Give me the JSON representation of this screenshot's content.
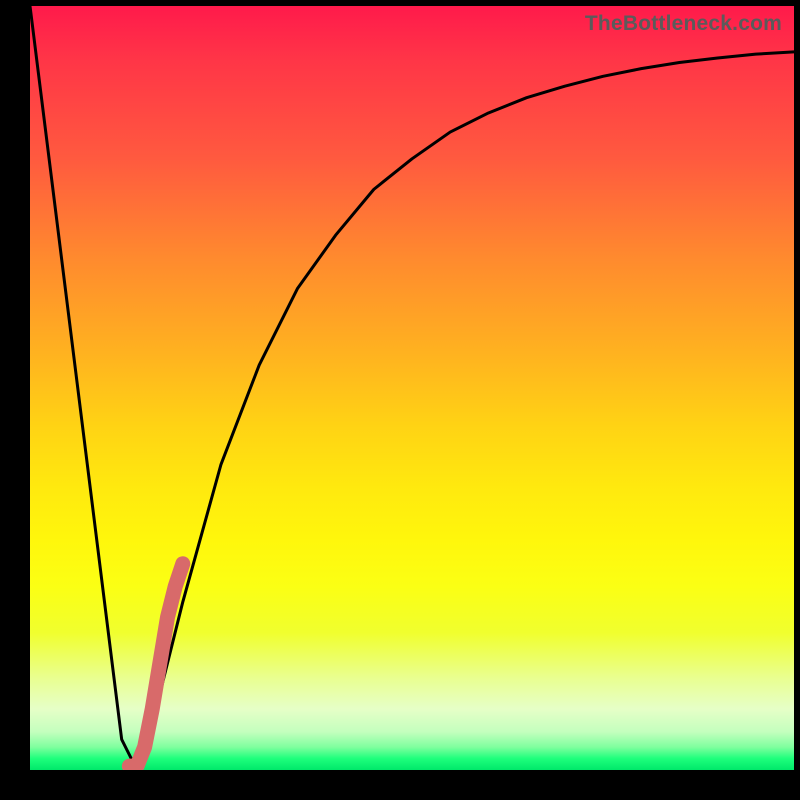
{
  "watermark": "TheBottleneck.com",
  "colors": {
    "curve": "#000000",
    "highlight": "#d86a6a",
    "frame": "#000000"
  },
  "chart_data": {
    "type": "line",
    "title": "",
    "xlabel": "",
    "ylabel": "",
    "xlim": [
      0,
      100
    ],
    "ylim": [
      0,
      100
    ],
    "series": [
      {
        "name": "bottleneck-curve",
        "x": [
          0,
          5,
          10,
          12,
          14,
          16,
          18,
          20,
          25,
          30,
          35,
          40,
          45,
          50,
          55,
          60,
          65,
          70,
          75,
          80,
          85,
          90,
          95,
          100
        ],
        "values": [
          100,
          60,
          20,
          4,
          0,
          6,
          14,
          22,
          40,
          53,
          63,
          70,
          76,
          80,
          83.5,
          86,
          88,
          89.5,
          90.8,
          91.8,
          92.6,
          93.2,
          93.7,
          94
        ]
      },
      {
        "name": "highlight-segment",
        "x": [
          13,
          14,
          15,
          16,
          17,
          18,
          19,
          20
        ],
        "values": [
          0.5,
          0.5,
          3,
          8,
          14,
          20,
          24,
          27
        ]
      }
    ]
  }
}
